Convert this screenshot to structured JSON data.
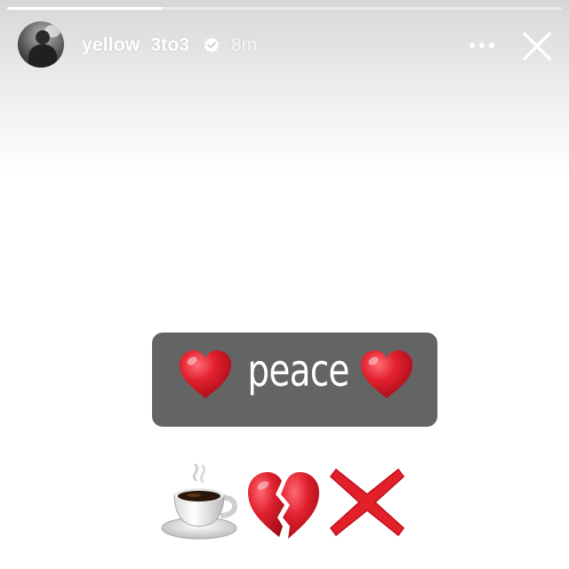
{
  "story": {
    "progress": 0.28
  },
  "header": {
    "username": "yellow_3to3",
    "verified": true,
    "time_ago": "8m",
    "icons": {
      "avatar": "profile-photo",
      "verified": "verified-badge-icon",
      "more": "more-icon",
      "close": "close-icon"
    }
  },
  "sticker": {
    "text": "peace",
    "background": "#646464",
    "left_emoji": "red-heart",
    "right_emoji": "red-heart"
  },
  "emoji_row": {
    "items": [
      "hot-beverage",
      "broken-heart",
      "cross-mark"
    ]
  },
  "colors": {
    "heart_red": "#e0202e",
    "cross_red": "#e2202a"
  }
}
